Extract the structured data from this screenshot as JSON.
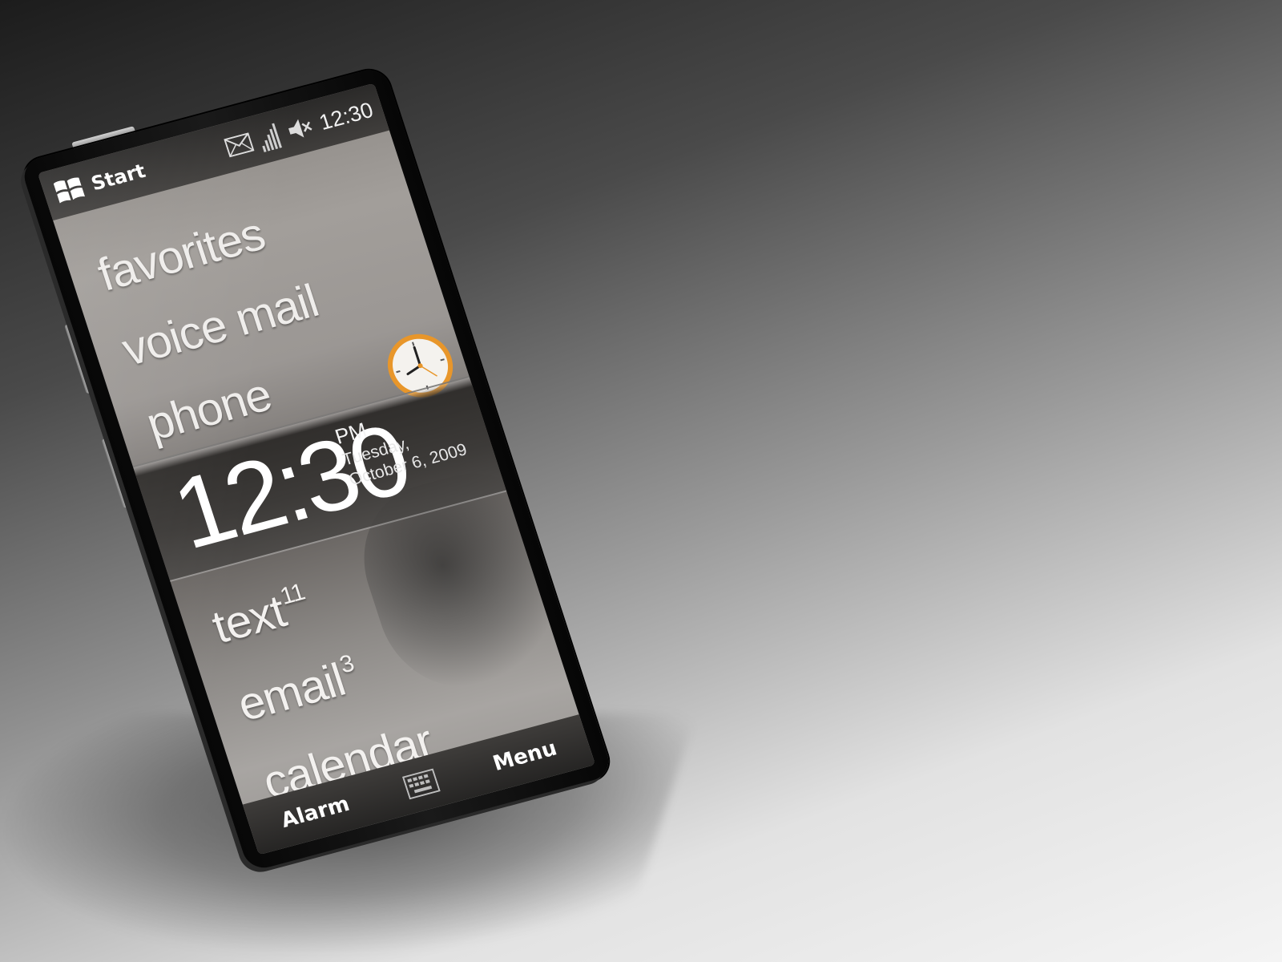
{
  "status_bar": {
    "start_label": "Start",
    "time": "12:30",
    "icons": [
      "windows-logo-icon",
      "envelope-icon",
      "signal-strength-icon",
      "speaker-muted-icon"
    ]
  },
  "menu": {
    "items": [
      {
        "label": "favorites"
      },
      {
        "label": "voice mail"
      },
      {
        "label": "phone"
      }
    ]
  },
  "clock": {
    "time": "12:30",
    "ampm": "PM",
    "weekday": "Tuesday,",
    "date": "October 6, 2009",
    "icon": "analog-clock-icon"
  },
  "notifications": {
    "items": [
      {
        "label": "text",
        "count": "11"
      },
      {
        "label": "email",
        "count": "3"
      },
      {
        "label": "calendar",
        "count": ""
      }
    ]
  },
  "softkeys": {
    "left": "Alarm",
    "right": "Menu",
    "center_icon": "keyboard-icon"
  },
  "colors": {
    "clock_accent": "#e8962a",
    "status_bar": "#2b2a29",
    "text": "#efedeb"
  }
}
